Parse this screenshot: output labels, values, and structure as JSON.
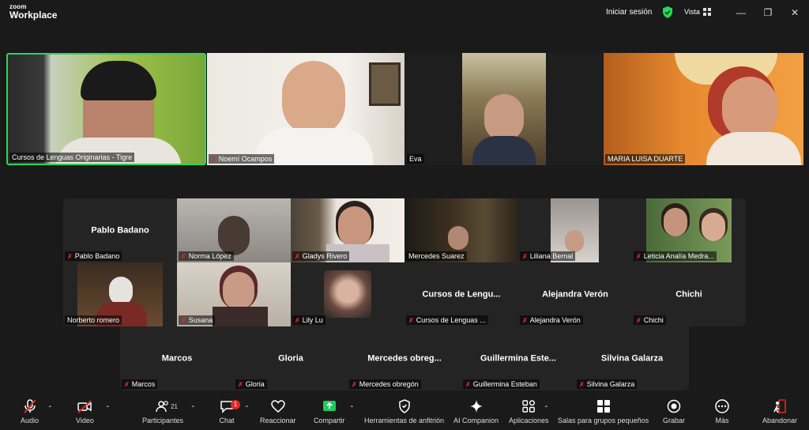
{
  "app": {
    "logo_small": "zoom",
    "logo_big": "Workplace"
  },
  "titlebar": {
    "signin": "Iniciar sesión",
    "view": "Vista"
  },
  "top_tiles": [
    {
      "name": "Cursos de Lenguas Originarias - Tigre",
      "muted": false
    },
    {
      "name": "Noemí Ocampos",
      "muted": true
    },
    {
      "name": "Eva",
      "muted": false
    },
    {
      "name": "MARIA LUISA DUARTE",
      "muted": false
    }
  ],
  "grid": {
    "row1": [
      {
        "name": "Pablo Badano",
        "big": "Pablo Badano"
      },
      {
        "name": "Norma López"
      },
      {
        "name": "Gladys Rivero"
      },
      {
        "name": "Mercedes Suarez"
      },
      {
        "name": "Liliana Bernal"
      },
      {
        "name": "Leticia Analía Medra..."
      }
    ],
    "row2": [
      {
        "name": "Norberto romero"
      },
      {
        "name": "Susana"
      },
      {
        "name": "Lily Lu"
      },
      {
        "name": "Cursos de Lenguas ...",
        "big": "Cursos de Lengu..."
      },
      {
        "name": "Alejandra Verón",
        "big": "Alejandra Verón"
      },
      {
        "name": "Chichi",
        "big": "Chichi"
      }
    ],
    "row3": [
      {
        "name": "Marcos",
        "big": "Marcos"
      },
      {
        "name": "Gloria",
        "big": "Gloria"
      },
      {
        "name": "Mercedes obregón",
        "big": "Mercedes obreg..."
      },
      {
        "name": "Guillermina Esteban",
        "big": "Guillermina Este..."
      },
      {
        "name": "Silvina Galarza",
        "big": "Silvina Galarza"
      }
    ]
  },
  "toolbar": {
    "audio": "Audio",
    "video": "Video",
    "participants": "Participantes",
    "participants_count": "21",
    "chat": "Chat",
    "chat_badge": "1",
    "react": "Reaccionar",
    "share": "Compartir",
    "host_tools": "Herramientas de anfitrión",
    "companion": "AI Companion",
    "apps": "Aplicaciones",
    "rooms": "Salas para grupos pequeños",
    "record": "Grabar",
    "more": "Más",
    "leave": "Abandonar"
  },
  "colors": {
    "accent_green": "#23d959",
    "muted_red": "#e02828",
    "share_green": "#1ecb5c",
    "leave_red": "#e02828"
  }
}
